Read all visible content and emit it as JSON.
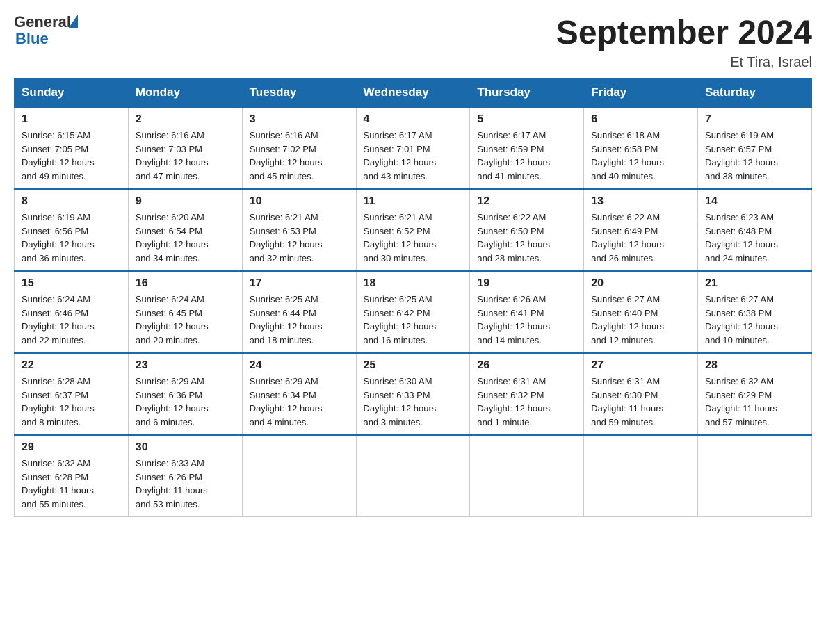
{
  "header": {
    "logo_text_general": "General",
    "logo_text_blue": "Blue",
    "title": "September 2024",
    "location": "Et Tira, Israel"
  },
  "days_of_week": [
    "Sunday",
    "Monday",
    "Tuesday",
    "Wednesday",
    "Thursday",
    "Friday",
    "Saturday"
  ],
  "weeks": [
    [
      {
        "day": "1",
        "sunrise": "6:15 AM",
        "sunset": "7:05 PM",
        "daylight": "12 hours and 49 minutes."
      },
      {
        "day": "2",
        "sunrise": "6:16 AM",
        "sunset": "7:03 PM",
        "daylight": "12 hours and 47 minutes."
      },
      {
        "day": "3",
        "sunrise": "6:16 AM",
        "sunset": "7:02 PM",
        "daylight": "12 hours and 45 minutes."
      },
      {
        "day": "4",
        "sunrise": "6:17 AM",
        "sunset": "7:01 PM",
        "daylight": "12 hours and 43 minutes."
      },
      {
        "day": "5",
        "sunrise": "6:17 AM",
        "sunset": "6:59 PM",
        "daylight": "12 hours and 41 minutes."
      },
      {
        "day": "6",
        "sunrise": "6:18 AM",
        "sunset": "6:58 PM",
        "daylight": "12 hours and 40 minutes."
      },
      {
        "day": "7",
        "sunrise": "6:19 AM",
        "sunset": "6:57 PM",
        "daylight": "12 hours and 38 minutes."
      }
    ],
    [
      {
        "day": "8",
        "sunrise": "6:19 AM",
        "sunset": "6:56 PM",
        "daylight": "12 hours and 36 minutes."
      },
      {
        "day": "9",
        "sunrise": "6:20 AM",
        "sunset": "6:54 PM",
        "daylight": "12 hours and 34 minutes."
      },
      {
        "day": "10",
        "sunrise": "6:21 AM",
        "sunset": "6:53 PM",
        "daylight": "12 hours and 32 minutes."
      },
      {
        "day": "11",
        "sunrise": "6:21 AM",
        "sunset": "6:52 PM",
        "daylight": "12 hours and 30 minutes."
      },
      {
        "day": "12",
        "sunrise": "6:22 AM",
        "sunset": "6:50 PM",
        "daylight": "12 hours and 28 minutes."
      },
      {
        "day": "13",
        "sunrise": "6:22 AM",
        "sunset": "6:49 PM",
        "daylight": "12 hours and 26 minutes."
      },
      {
        "day": "14",
        "sunrise": "6:23 AM",
        "sunset": "6:48 PM",
        "daylight": "12 hours and 24 minutes."
      }
    ],
    [
      {
        "day": "15",
        "sunrise": "6:24 AM",
        "sunset": "6:46 PM",
        "daylight": "12 hours and 22 minutes."
      },
      {
        "day": "16",
        "sunrise": "6:24 AM",
        "sunset": "6:45 PM",
        "daylight": "12 hours and 20 minutes."
      },
      {
        "day": "17",
        "sunrise": "6:25 AM",
        "sunset": "6:44 PM",
        "daylight": "12 hours and 18 minutes."
      },
      {
        "day": "18",
        "sunrise": "6:25 AM",
        "sunset": "6:42 PM",
        "daylight": "12 hours and 16 minutes."
      },
      {
        "day": "19",
        "sunrise": "6:26 AM",
        "sunset": "6:41 PM",
        "daylight": "12 hours and 14 minutes."
      },
      {
        "day": "20",
        "sunrise": "6:27 AM",
        "sunset": "6:40 PM",
        "daylight": "12 hours and 12 minutes."
      },
      {
        "day": "21",
        "sunrise": "6:27 AM",
        "sunset": "6:38 PM",
        "daylight": "12 hours and 10 minutes."
      }
    ],
    [
      {
        "day": "22",
        "sunrise": "6:28 AM",
        "sunset": "6:37 PM",
        "daylight": "12 hours and 8 minutes."
      },
      {
        "day": "23",
        "sunrise": "6:29 AM",
        "sunset": "6:36 PM",
        "daylight": "12 hours and 6 minutes."
      },
      {
        "day": "24",
        "sunrise": "6:29 AM",
        "sunset": "6:34 PM",
        "daylight": "12 hours and 4 minutes."
      },
      {
        "day": "25",
        "sunrise": "6:30 AM",
        "sunset": "6:33 PM",
        "daylight": "12 hours and 3 minutes."
      },
      {
        "day": "26",
        "sunrise": "6:31 AM",
        "sunset": "6:32 PM",
        "daylight": "12 hours and 1 minute."
      },
      {
        "day": "27",
        "sunrise": "6:31 AM",
        "sunset": "6:30 PM",
        "daylight": "11 hours and 59 minutes."
      },
      {
        "day": "28",
        "sunrise": "6:32 AM",
        "sunset": "6:29 PM",
        "daylight": "11 hours and 57 minutes."
      }
    ],
    [
      {
        "day": "29",
        "sunrise": "6:32 AM",
        "sunset": "6:28 PM",
        "daylight": "11 hours and 55 minutes."
      },
      {
        "day": "30",
        "sunrise": "6:33 AM",
        "sunset": "6:26 PM",
        "daylight": "11 hours and 53 minutes."
      },
      null,
      null,
      null,
      null,
      null
    ]
  ],
  "labels": {
    "sunrise": "Sunrise:",
    "sunset": "Sunset:",
    "daylight": "Daylight:"
  }
}
